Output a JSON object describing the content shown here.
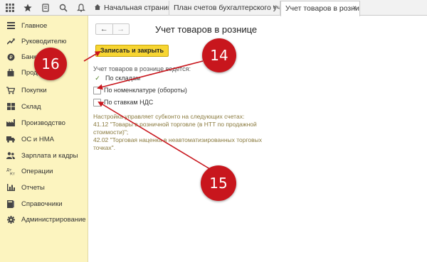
{
  "tabs": [
    {
      "label": "Начальная страница",
      "closable": false
    },
    {
      "label": "План счетов бухгалтерского учета",
      "closable": true
    },
    {
      "label": "Учет товаров в рознице",
      "closable": true,
      "active": true
    }
  ],
  "tab_close_glyph": "×",
  "toolbar_icons": [
    "apps-grid-icon",
    "star-icon",
    "history-icon",
    "search-icon",
    "bell-icon"
  ],
  "sidebar": {
    "items": [
      {
        "label": "Главное",
        "icon": "menu-icon"
      },
      {
        "label": "Руководителю",
        "icon": "trend-icon"
      },
      {
        "label": "Банк",
        "icon": "coin-icon"
      },
      {
        "label": "Продажи",
        "icon": "bag-icon"
      },
      {
        "label": "Покупки",
        "icon": "cart-icon"
      },
      {
        "label": "Склад",
        "icon": "warehouse-icon"
      },
      {
        "label": "Производство",
        "icon": "factory-icon"
      },
      {
        "label": "ОС и НМА",
        "icon": "truck-icon"
      },
      {
        "label": "Зарплата и кадры",
        "icon": "people-icon"
      },
      {
        "label": "Операции",
        "icon": "operations-icon"
      },
      {
        "label": "Отчеты",
        "icon": "chart-icon"
      },
      {
        "label": "Справочники",
        "icon": "book-icon"
      },
      {
        "label": "Администрирование",
        "icon": "gear-icon"
      }
    ]
  },
  "form": {
    "nav_back": "←",
    "nav_forward": "→",
    "title": "Учет товаров в рознице",
    "save_button": "Записать и закрыть",
    "caption": "Учет товаров в рознице ведется:",
    "options": [
      {
        "label": "По складам",
        "checked": true
      },
      {
        "label": "По номенклатуре (обороты)",
        "checked": false
      },
      {
        "label": "По ставкам НДС",
        "checked": false
      }
    ],
    "check_glyph": "✓",
    "note_lines": [
      "Настройка управляет субконто на следующих счетах:",
      "41.12 \"Товары в розничной торговле (в НТТ по продажной",
      "стоимости)\";",
      "42.02 \"Торговая наценка в неавтоматизированных торговых",
      "точках\"."
    ]
  },
  "callouts": [
    "16",
    "14",
    "15"
  ],
  "colors": {
    "accent_red": "#c8161d",
    "button_yellow": "#f7d532",
    "sidebar_bg": "#fcf4bf"
  }
}
